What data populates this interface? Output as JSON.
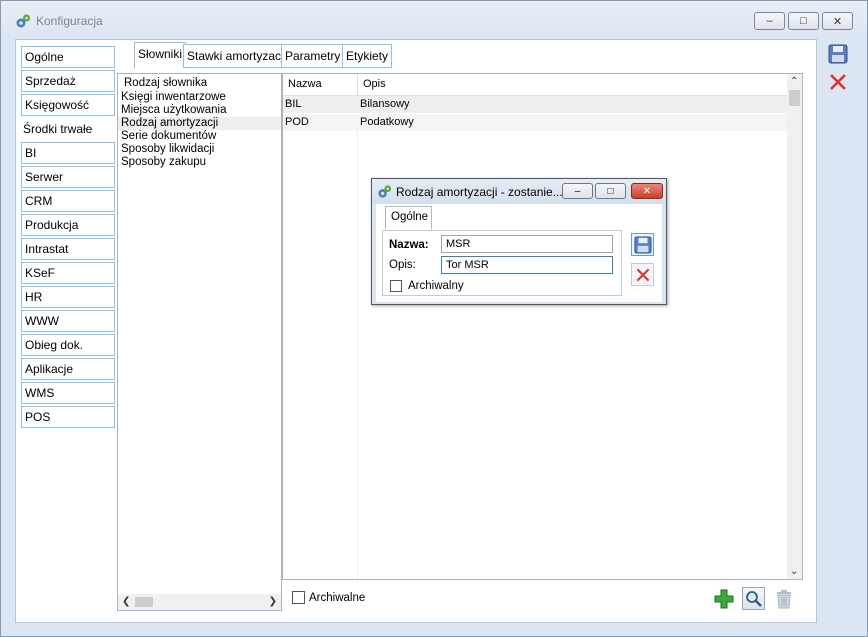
{
  "window": {
    "title": "Konfiguracja",
    "minimize": "–",
    "maximize": "□",
    "close": "✕"
  },
  "nav": {
    "items": [
      {
        "label": "Ogólne"
      },
      {
        "label": "Sprzedaż"
      },
      {
        "label": "Księgowość"
      },
      {
        "label": "Środki trwałe"
      },
      {
        "label": "BI"
      },
      {
        "label": "Serwer wydruków"
      },
      {
        "label": "CRM"
      },
      {
        "label": "Produkcja"
      },
      {
        "label": "Intrastat"
      },
      {
        "label": "KSeF"
      },
      {
        "label": "HR"
      },
      {
        "label": "WWW"
      },
      {
        "label": "Obieg dok."
      },
      {
        "label": "Aplikacje"
      },
      {
        "label": "WMS"
      },
      {
        "label": "POS"
      }
    ],
    "active": "Środki trwałe"
  },
  "tabs": [
    {
      "label": "Słowniki"
    },
    {
      "label": "Stawki amortyzacji"
    },
    {
      "label": "Parametry"
    },
    {
      "label": "Etykiety"
    }
  ],
  "dictionary": {
    "header": "Rodzaj słownika",
    "items": [
      {
        "label": "Księgi inwentarzowe"
      },
      {
        "label": "Miejsca użytkowania"
      },
      {
        "label": "Rodzaj amortyzacji"
      },
      {
        "label": "Serie dokumentów"
      },
      {
        "label": "Sposoby likwidacji"
      },
      {
        "label": "Sposoby zakupu"
      }
    ],
    "selected": "Rodzaj amortyzacji"
  },
  "grid": {
    "columns": [
      "Nazwa",
      "Opis"
    ],
    "rows": [
      {
        "nazwa": "BIL",
        "opis": "Bilansowy"
      },
      {
        "nazwa": "POD",
        "opis": "Podatkowy"
      }
    ]
  },
  "bottom": {
    "archiwalne_label": "Archiwalne"
  },
  "dialog": {
    "title": "Rodzaj amortyzacji - zostanie...",
    "tab": "Ogólne",
    "nazwa_label": "Nazwa:",
    "nazwa_value": "MSR",
    "opis_label": "Opis:",
    "opis_value": "Tor MSR",
    "archiwalny_label": "Archiwalny"
  },
  "colors": {
    "accent": "#8fc0e6",
    "delete_red": "#d9342b",
    "add_green": "#3aa83a"
  }
}
